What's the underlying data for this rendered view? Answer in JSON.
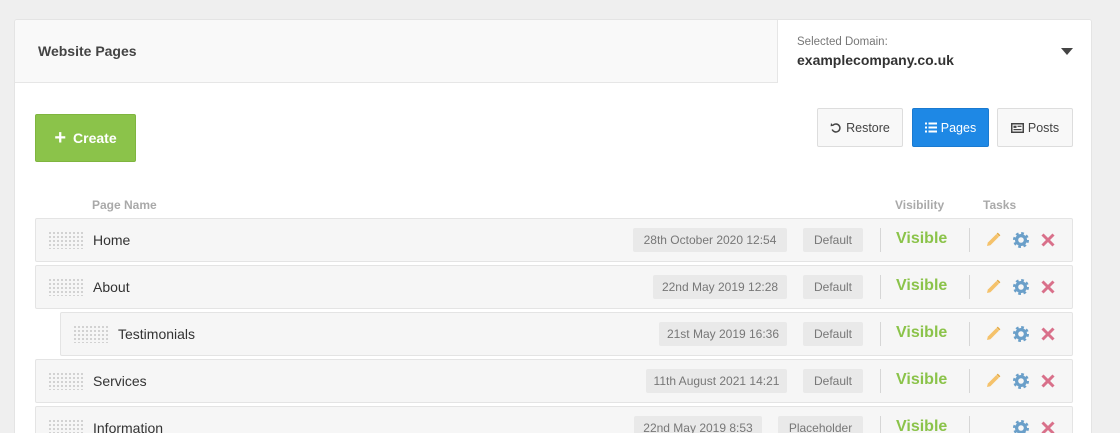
{
  "header": {
    "title": "Website Pages",
    "domain_label": "Selected Domain:",
    "domain_value": "examplecompany.co.uk"
  },
  "toolbar": {
    "create_label": "Create",
    "restore_label": "Restore",
    "pages_label": "Pages",
    "posts_label": "Posts"
  },
  "columns": {
    "page_name": "Page Name",
    "visibility": "Visibility",
    "tasks": "Tasks"
  },
  "colors": {
    "accent_green": "#8bc34a",
    "accent_blue": "#1e88e5",
    "edit_icon": "#f5c26b",
    "settings_icon": "#6a9fc9",
    "delete_icon": "#d9708a"
  },
  "icons": {
    "create": "plus-icon",
    "restore": "undo-icon",
    "pages": "list-icon",
    "posts": "newspaper-icon",
    "dropdown": "caret-down-icon",
    "edit": "pencil-icon",
    "settings": "gear-icon",
    "delete": "close-icon",
    "drag": "drag-handle-icon"
  },
  "pages": [
    {
      "name": "Home",
      "date": "28th October 2020 12:54",
      "type": "Default",
      "visibility": "Visible"
    },
    {
      "name": "About",
      "date": "22nd May 2019 12:28",
      "type": "Default",
      "visibility": "Visible"
    },
    {
      "name": "Testimonials",
      "date": "21st May 2019 16:36",
      "type": "Default",
      "visibility": "Visible"
    },
    {
      "name": "Services",
      "date": "11th August 2021 14:21",
      "type": "Default",
      "visibility": "Visible"
    },
    {
      "name": "Information",
      "date": "22nd May 2019 8:53",
      "type": "Placeholder",
      "visibility": "Visible"
    }
  ]
}
